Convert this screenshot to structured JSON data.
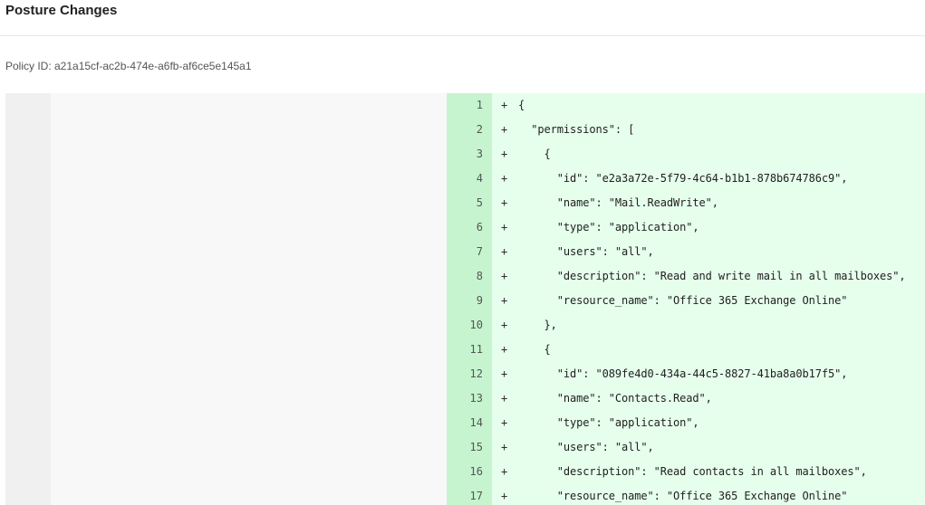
{
  "page": {
    "title": "Posture Changes",
    "policy_id_label": "Policy ID: a21a15cf-ac2b-474e-a6fb-af6ce5e145a1"
  },
  "diff": {
    "added_marker": "+",
    "colors": {
      "added_gutter": "#c6f4cf",
      "added_background": "#e6ffec",
      "empty_gutter": "#f0f0f1",
      "empty_background": "#f8f8f9"
    },
    "lines": [
      {
        "num": "1",
        "code": "{"
      },
      {
        "num": "2",
        "code": "  \"permissions\": ["
      },
      {
        "num": "3",
        "code": "    {"
      },
      {
        "num": "4",
        "code": "      \"id\": \"e2a3a72e-5f79-4c64-b1b1-878b674786c9\","
      },
      {
        "num": "5",
        "code": "      \"name\": \"Mail.ReadWrite\","
      },
      {
        "num": "6",
        "code": "      \"type\": \"application\","
      },
      {
        "num": "7",
        "code": "      \"users\": \"all\","
      },
      {
        "num": "8",
        "code": "      \"description\": \"Read and write mail in all mailboxes\","
      },
      {
        "num": "9",
        "code": "      \"resource_name\": \"Office 365 Exchange Online\""
      },
      {
        "num": "10",
        "code": "    },"
      },
      {
        "num": "11",
        "code": "    {"
      },
      {
        "num": "12",
        "code": "      \"id\": \"089fe4d0-434a-44c5-8827-41ba8a0b17f5\","
      },
      {
        "num": "13",
        "code": "      \"name\": \"Contacts.Read\","
      },
      {
        "num": "14",
        "code": "      \"type\": \"application\","
      },
      {
        "num": "15",
        "code": "      \"users\": \"all\","
      },
      {
        "num": "16",
        "code": "      \"description\": \"Read contacts in all mailboxes\","
      },
      {
        "num": "17",
        "code": "      \"resource_name\": \"Office 365 Exchange Online\""
      }
    ]
  }
}
